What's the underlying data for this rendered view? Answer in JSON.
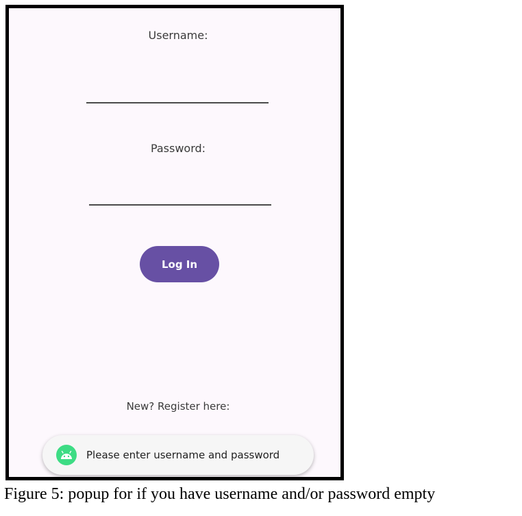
{
  "login_screen": {
    "username_label": "Username:",
    "username_value": "",
    "password_label": "Password:",
    "password_value": "",
    "login_button_label": "Log In",
    "register_link_text": "New? Register here:",
    "accent_color": "#6750a4",
    "background_color": "#fdf8fd"
  },
  "toast": {
    "icon": "android-icon",
    "icon_color": "#3ddc84",
    "message": "Please enter username and password"
  },
  "caption": "Figure 5: popup for if you have username and/or password empty"
}
